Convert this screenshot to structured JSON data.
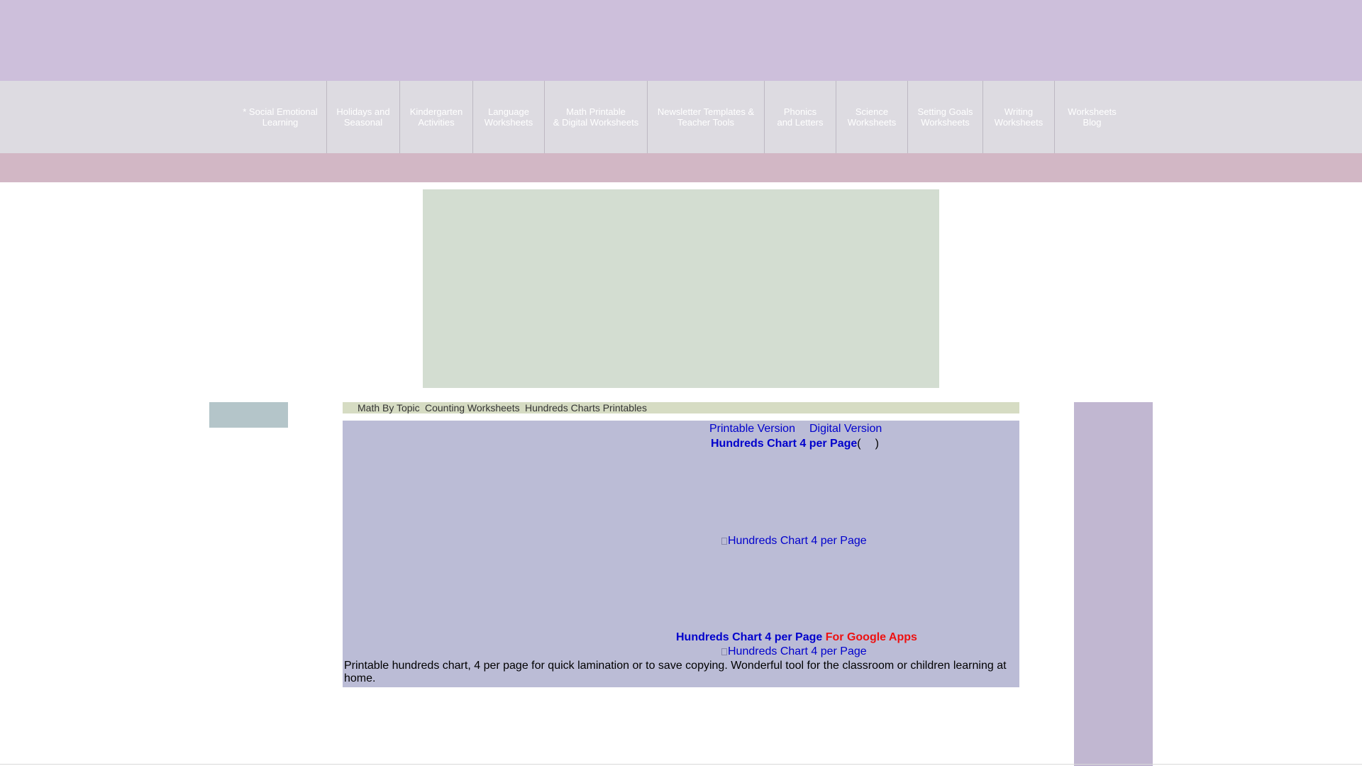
{
  "colors": {
    "top_banner": "#cdbfdb",
    "nav_bar": "#dddbe1",
    "pink_strip": "#d2b7c5",
    "ad_box": "#d3ddd1",
    "left_box": "#b4c5c9",
    "right_sidebar": "#c1b7d1",
    "breadcrumb_bg": "#d6dcc3",
    "content_bg": "#bbbcd6",
    "link": "#0000cc",
    "accent_red": "#ee1111"
  },
  "nav": {
    "items": [
      {
        "line1": "* Social Emotional",
        "line2": "Learning"
      },
      {
        "line1": "Holidays and",
        "line2": "Seasonal"
      },
      {
        "line1": "Kindergarten",
        "line2": "Activities"
      },
      {
        "line1": "Language",
        "line2": "Worksheets"
      },
      {
        "line1": "Math Printable",
        "line2": "& Digital Worksheets"
      },
      {
        "line1": "Newsletter Templates &",
        "line2": "Teacher Tools"
      },
      {
        "line1": "Phonics",
        "line2": "and Letters"
      },
      {
        "line1": "Science",
        "line2": "Worksheets"
      },
      {
        "line1": "Setting Goals",
        "line2": "Worksheets"
      },
      {
        "line1": "Writing",
        "line2": "Worksheets"
      },
      {
        "line1": "Worksheets",
        "line2": "Blog"
      }
    ]
  },
  "breadcrumb": {
    "items": [
      "Math By Topic",
      "Counting Worksheets",
      "Hundreds Charts Printables"
    ]
  },
  "content": {
    "printable_link": "Printable Version",
    "digital_link": "Digital Version",
    "chart_title": "Hundreds Chart 4 per Page",
    "paren_open": "(",
    "paren_close": ")",
    "image_alt_1": "Hundreds Chart 4 per Page",
    "google_title": "Hundreds Chart 4 per Page",
    "google_suffix": "For Google Apps",
    "image_alt_2": "Hundreds Chart 4 per Page",
    "description": "Printable hundreds chart, 4 per page for quick lamination or to save copying. Wonderful tool for the classroom or children learning at home."
  }
}
